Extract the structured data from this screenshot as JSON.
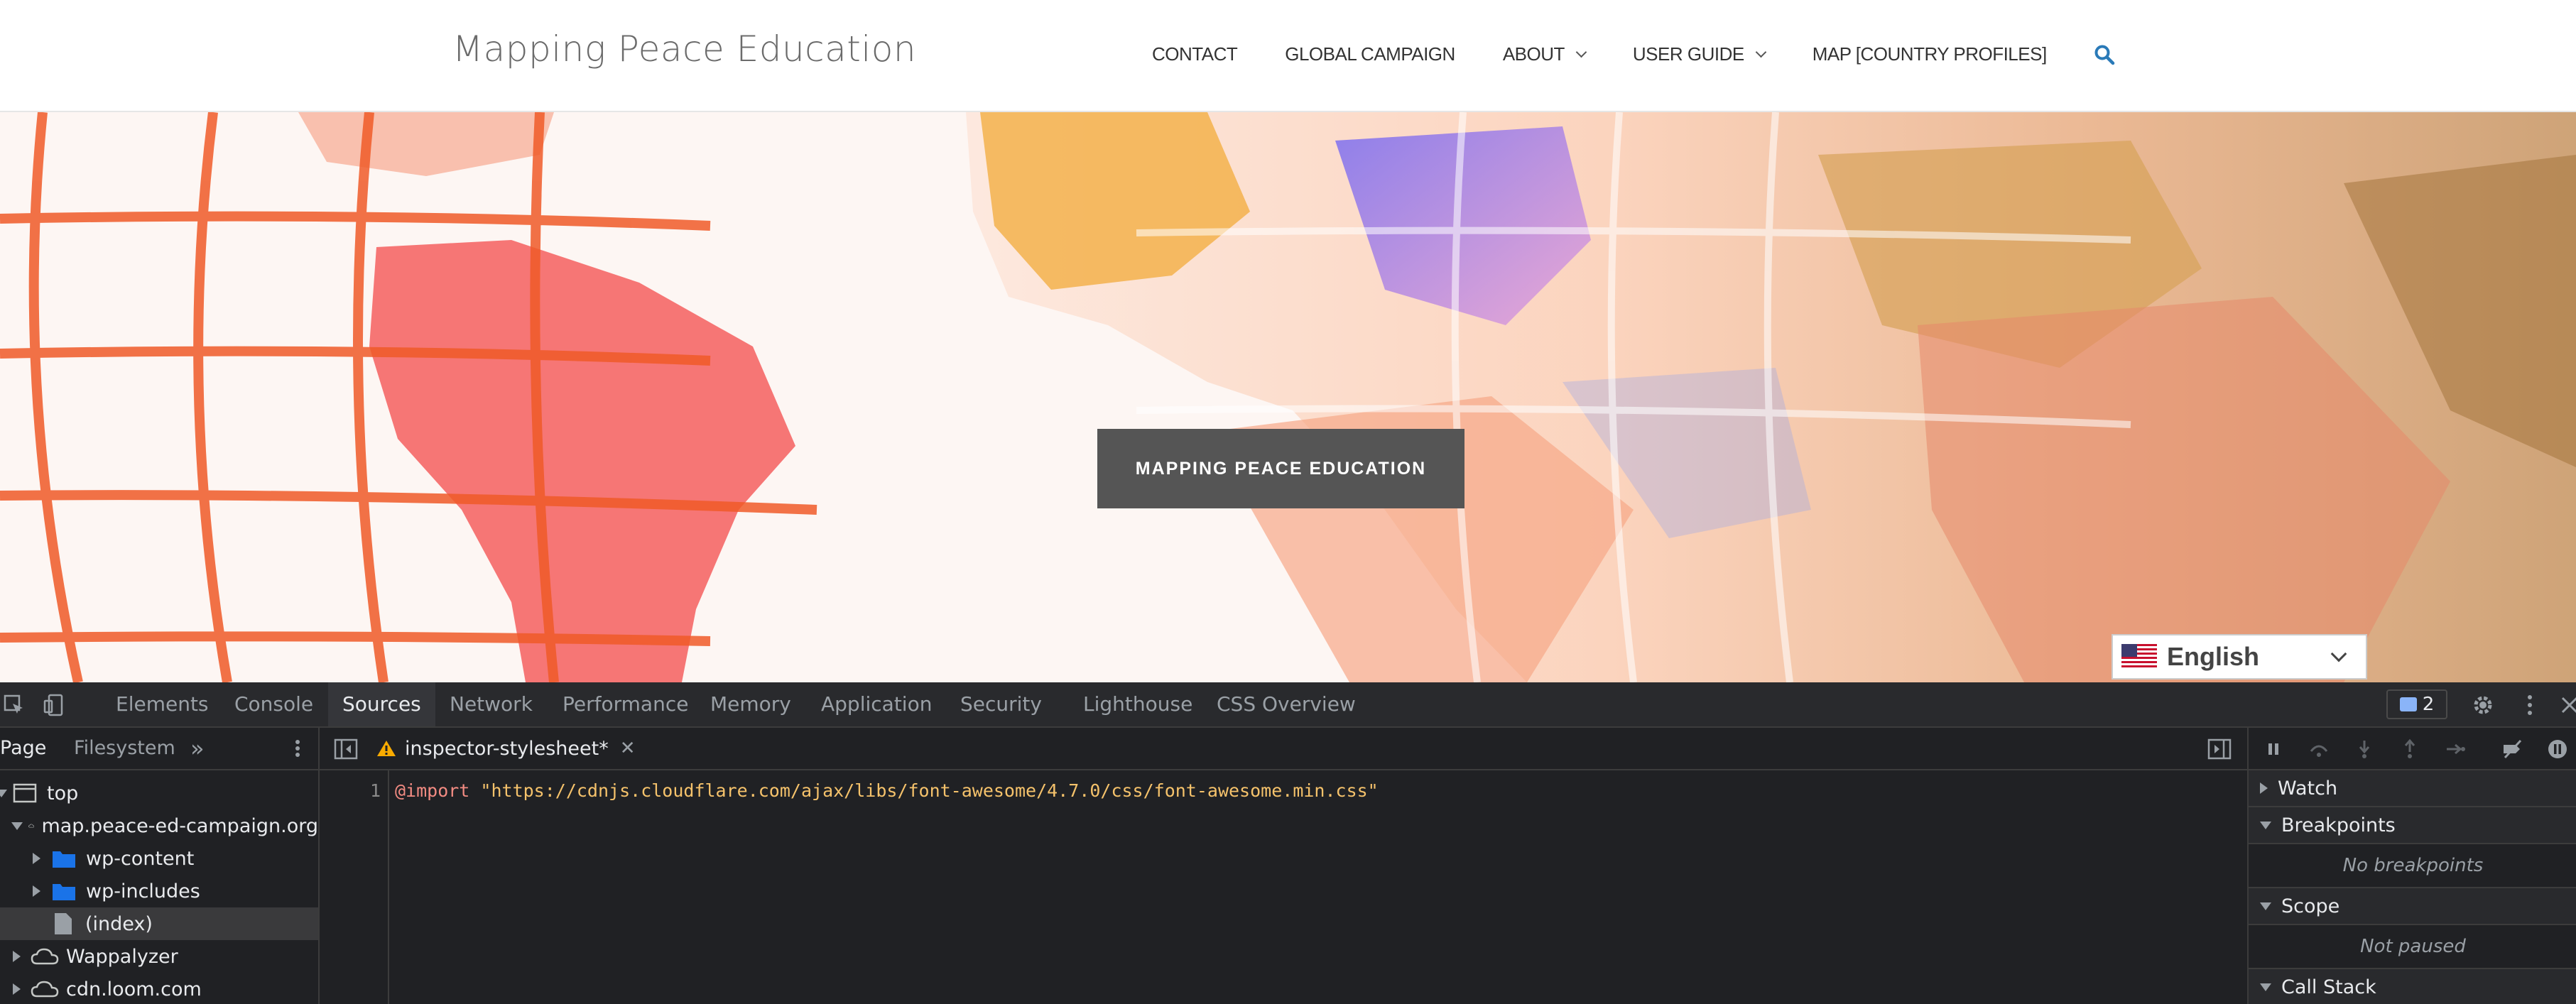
{
  "site": {
    "title": "Mapping Peace Education",
    "nav": [
      {
        "label": "CONTACT",
        "has_dropdown": false
      },
      {
        "label": "GLOBAL CAMPAIGN",
        "has_dropdown": false
      },
      {
        "label": "ABOUT",
        "has_dropdown": true
      },
      {
        "label": "USER GUIDE",
        "has_dropdown": true
      },
      {
        "label": "MAP [COUNTRY PROFILES]",
        "has_dropdown": false
      }
    ],
    "search_icon": "search-icon",
    "accent_color": "#2a7ab8"
  },
  "hero": {
    "button_label": "MAPPING PEACE EDUCATION",
    "language": "English"
  },
  "devtools": {
    "tabs": [
      "Elements",
      "Console",
      "Sources",
      "Network",
      "Performance",
      "Memory",
      "Application",
      "Security",
      "Lighthouse",
      "CSS Overview"
    ],
    "active_tab": "Sources",
    "message_count": "2",
    "navigator": {
      "tabs": [
        "Page",
        "Filesystem"
      ],
      "tree": [
        {
          "label": "top",
          "icon": "frame-icon",
          "depth": 0,
          "expanded": true
        },
        {
          "label": "map.peace-ed-campaign.org",
          "icon": "cloud-icon",
          "depth": 1,
          "expanded": true
        },
        {
          "label": "wp-content",
          "icon": "folder-icon",
          "depth": 2,
          "expanded": false
        },
        {
          "label": "wp-includes",
          "icon": "folder-icon",
          "depth": 2,
          "expanded": false
        },
        {
          "label": "(index)",
          "icon": "file-icon",
          "depth": 2,
          "selected": true
        },
        {
          "label": "Wappalyzer",
          "icon": "cloud-icon",
          "depth": 1,
          "expanded": false
        },
        {
          "label": "cdn.loom.com",
          "icon": "cloud-icon",
          "depth": 1,
          "expanded": false
        }
      ]
    },
    "editor": {
      "file_tab": "inspector-stylesheet*",
      "line_number": "1",
      "code_keyword": "@import",
      "code_string": "\"https://cdnjs.cloudflare.com/ajax/libs/font-awesome/4.7.0/css/font-awesome.min.css\""
    },
    "debugger": {
      "watch": "Watch",
      "breakpoints": "Breakpoints",
      "breakpoints_empty": "No breakpoints",
      "scope": "Scope",
      "scope_empty": "Not paused",
      "call_stack": "Call Stack"
    }
  }
}
